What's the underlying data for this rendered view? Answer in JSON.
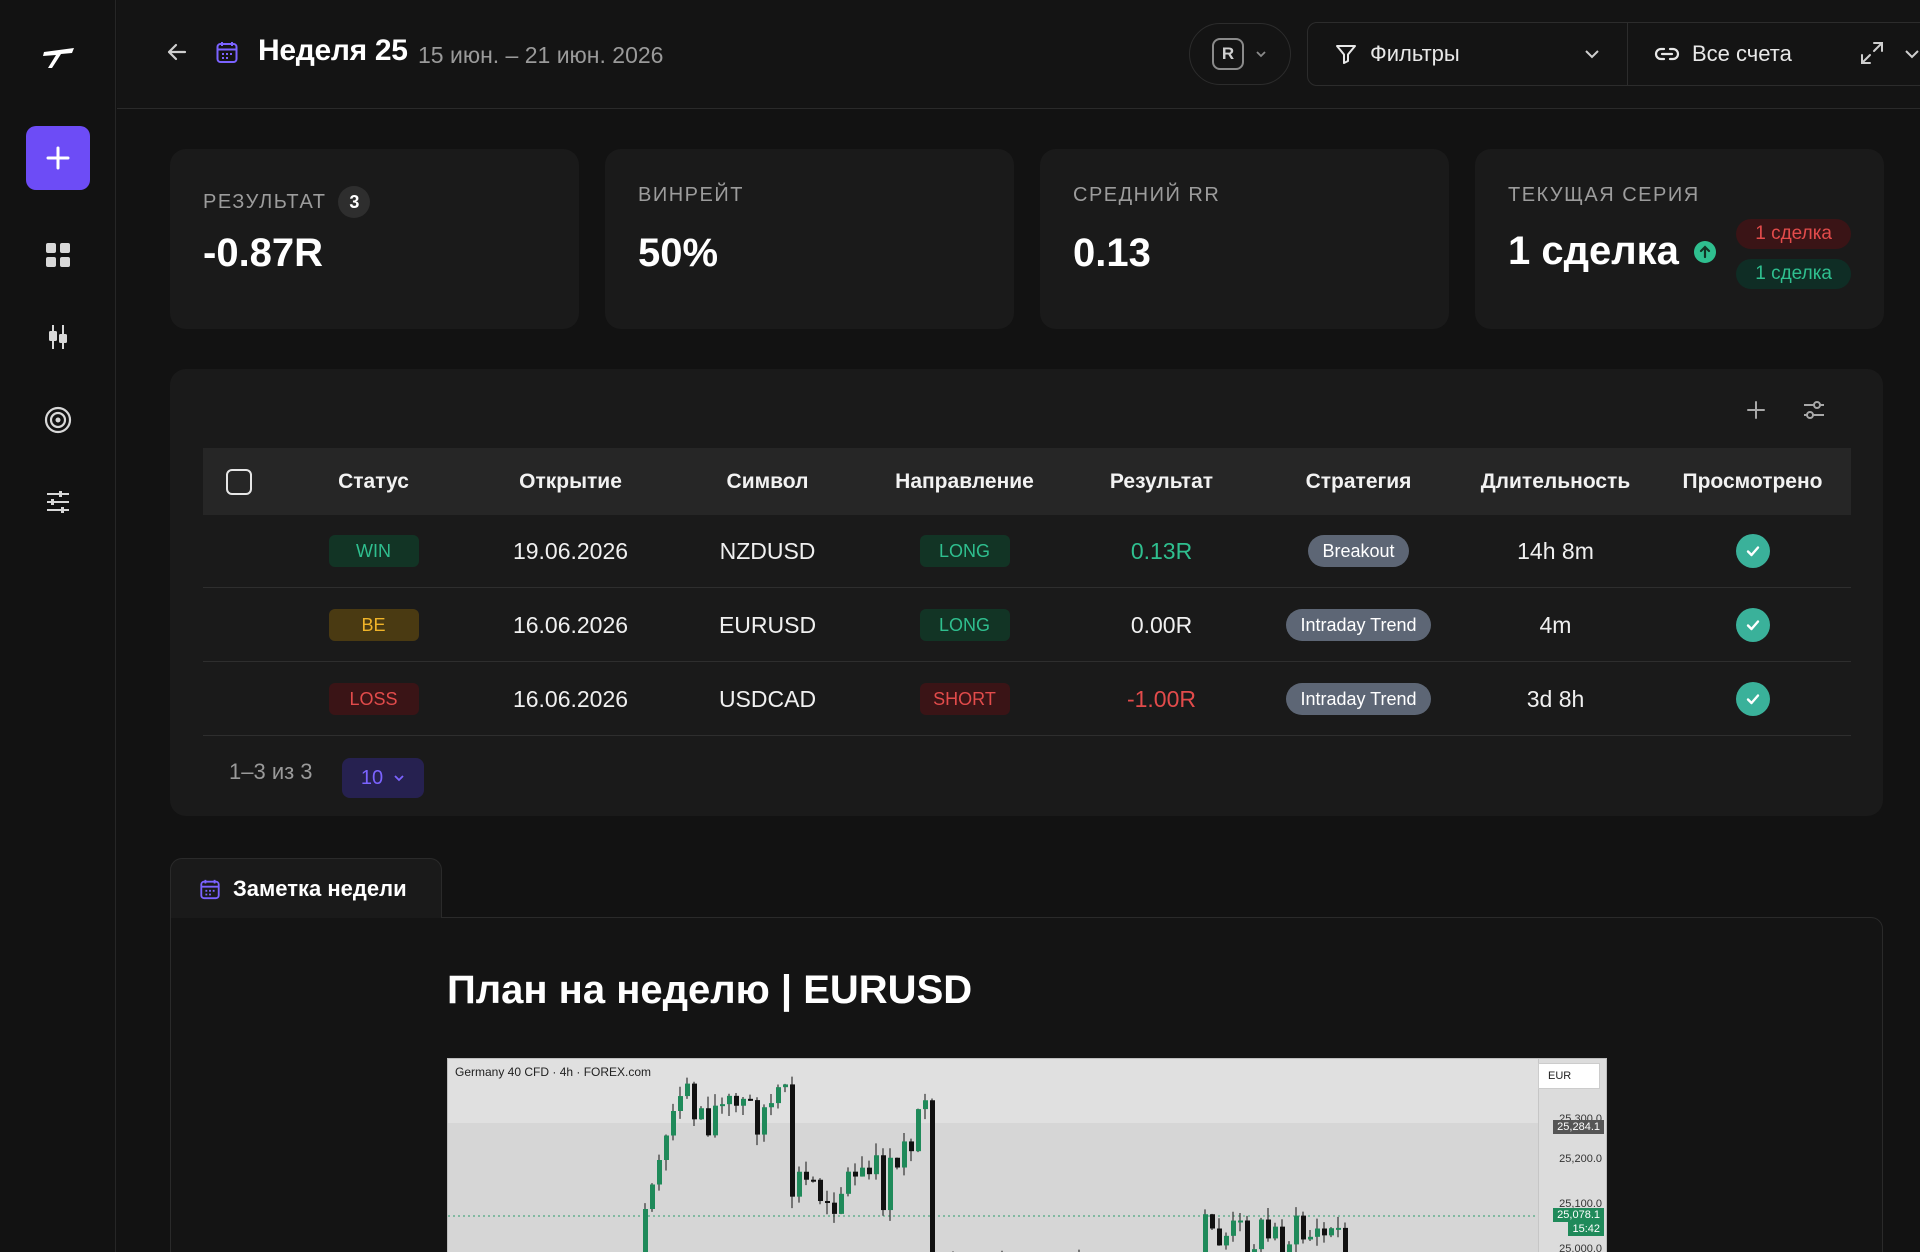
{
  "header": {
    "week_title": "Неделя 25",
    "week_range": "15 июн. – 21 июн. 2026",
    "r_label": "R",
    "filters_label": "Фильтры",
    "accounts_label": "Все счета"
  },
  "stats": {
    "result": {
      "label": "РЕЗУЛЬТАТ",
      "count": "3",
      "value": "-0.87R"
    },
    "winrate": {
      "label": "ВИНРЕЙТ",
      "value": "50%"
    },
    "avg_rr": {
      "label": "СРЕДНИЙ RR",
      "value": "0.13"
    },
    "streak": {
      "label": "ТЕКУЩАЯ СЕРИЯ",
      "value": "1 сделка",
      "loss_pill": "1 сделка",
      "win_pill": "1 сделка"
    }
  },
  "table": {
    "columns": [
      "Статус",
      "Открытие",
      "Символ",
      "Направление",
      "Результат",
      "Стратегия",
      "Длительность",
      "Просмотрено"
    ],
    "rows": [
      {
        "status": "WIN",
        "open": "19.06.2026",
        "symbol": "NZDUSD",
        "direction": "LONG",
        "result": "0.13R",
        "strategy": "Breakout",
        "duration": "14h 8m"
      },
      {
        "status": "BE",
        "open": "16.06.2026",
        "symbol": "EURUSD",
        "direction": "LONG",
        "result": "0.00R",
        "strategy": "Intraday Trend",
        "duration": "4m"
      },
      {
        "status": "LOSS",
        "open": "16.06.2026",
        "symbol": "USDCAD",
        "direction": "SHORT",
        "result": "-1.00R",
        "strategy": "Intraday Trend",
        "duration": "3d 8h"
      }
    ],
    "pager": "1–3 из 3",
    "per_page": "10"
  },
  "note": {
    "tab_label": "Заметка недели",
    "heading": "План на неделю | EURUSD",
    "image": {
      "caption": "Germany 40 CFD · 4h · FOREX.com",
      "currency": "EUR",
      "prices": [
        "25,300.0",
        "25,200.0",
        "25,100.0",
        "25,000.0"
      ],
      "tag_top": "25,284.1",
      "tag_bottom": "25,078.1",
      "tag_time": "15:42"
    }
  },
  "colors": {
    "accent": "#6d4cf6",
    "win": "#2fbf8f",
    "loss": "#e24b4b",
    "be": "#f0b429"
  }
}
